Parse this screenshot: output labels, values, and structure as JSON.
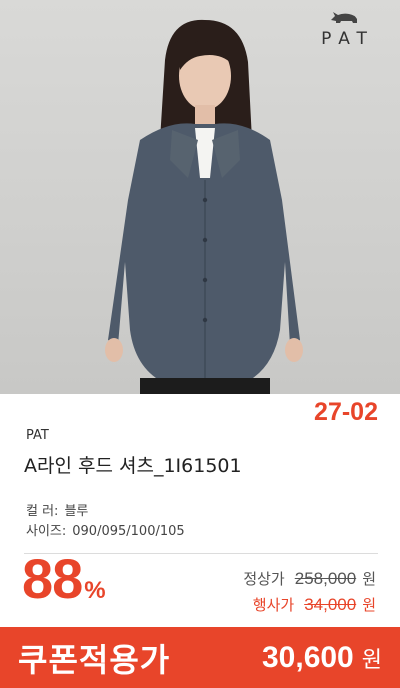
{
  "brand_logo": {
    "text": "PAT",
    "icon": "rhino-icon"
  },
  "product": {
    "code": "27-02",
    "brand": "PAT",
    "title": "A라인 후드 셔츠_1I61501",
    "specs": [
      {
        "key": "컬    러:",
        "value": "블루"
      },
      {
        "key": "사이즈:",
        "value": "090/095/100/105"
      }
    ]
  },
  "pricing": {
    "discount_number": "88",
    "discount_symbol": "%",
    "regular_label": "정상가",
    "regular_price": "258,000",
    "sale_label": "행사가",
    "sale_price": "34,000",
    "currency": "원"
  },
  "coupon": {
    "label": "쿠폰적용가",
    "price": "30,600",
    "currency": "원"
  },
  "colors": {
    "accent": "#e8452a",
    "background": "#ffffff",
    "photo_bg": "#d3d3d1"
  }
}
